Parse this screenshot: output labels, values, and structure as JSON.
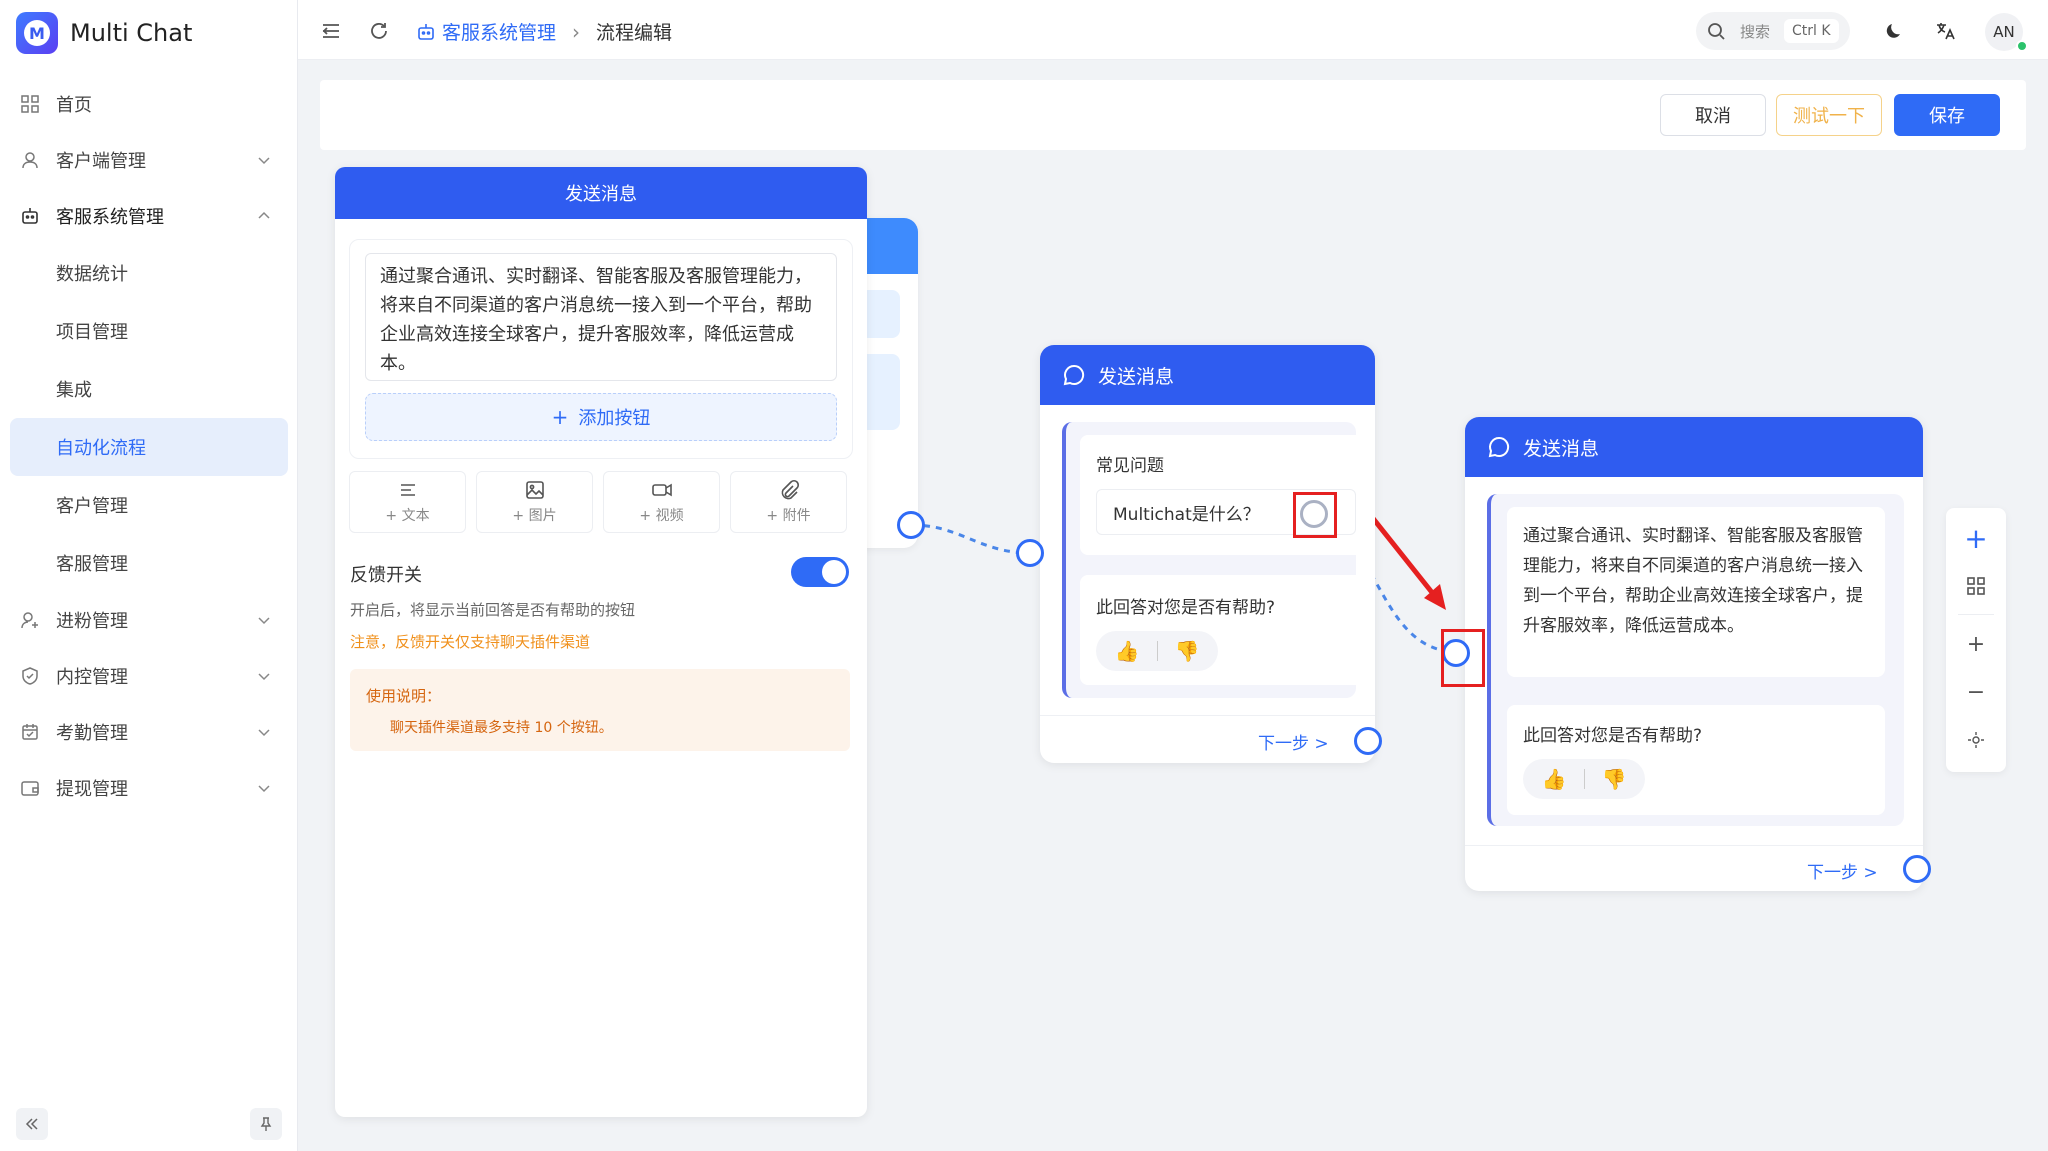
{
  "app": {
    "name": "Multi Chat",
    "logo_letter": "M"
  },
  "sidebar": {
    "items": [
      {
        "label": "首页",
        "icon": "grid-icon",
        "expandable": false
      },
      {
        "label": "客户端管理",
        "icon": "user-icon",
        "expandable": true,
        "expanded": false
      },
      {
        "label": "客服系统管理",
        "icon": "robot-icon",
        "expandable": true,
        "expanded": true
      },
      {
        "label": "进粉管理",
        "icon": "user-add-icon",
        "expandable": true,
        "expanded": false
      },
      {
        "label": "内控管理",
        "icon": "shield-icon",
        "expandable": true,
        "expanded": false
      },
      {
        "label": "考勤管理",
        "icon": "calendar-check-icon",
        "expandable": true,
        "expanded": false
      },
      {
        "label": "提现管理",
        "icon": "wallet-icon",
        "expandable": true,
        "expanded": false
      }
    ],
    "sub_items": [
      {
        "label": "数据统计",
        "active": false
      },
      {
        "label": "项目管理",
        "active": false
      },
      {
        "label": "集成",
        "active": false
      },
      {
        "label": "自动化流程",
        "active": true
      },
      {
        "label": "客户管理",
        "active": false
      },
      {
        "label": "客服管理",
        "active": false
      }
    ]
  },
  "header": {
    "breadcrumb_parent": "客服系统管理",
    "breadcrumb_current": "流程编辑",
    "search_placeholder": "搜索",
    "search_shortcut": "Ctrl K",
    "avatar_initials": "AN"
  },
  "toolbar": {
    "cancel_label": "取消",
    "test_label": "测试一下",
    "save_label": "保存"
  },
  "editor": {
    "title": "发送消息",
    "message_text": "通过聚合通讯、实时翻译、智能客服及客服管理能力，将来自不同渠道的客户消息统一接入到一个平台，帮助企业高效连接全球客户，提升客服效率，降低运营成本。",
    "add_button_label": "添加按钮",
    "type_buttons": [
      {
        "label": "+ 文本",
        "icon": "text-lines-icon"
      },
      {
        "label": "+ 图片",
        "icon": "image-icon"
      },
      {
        "label": "+ 视频",
        "icon": "video-icon"
      },
      {
        "label": "+ 附件",
        "icon": "paperclip-icon"
      }
    ],
    "feedback_title": "反馈开关",
    "feedback_enabled": true,
    "feedback_desc": "开启后，将显示当前回答是否有帮助的按钮",
    "feedback_warning": "注意，反馈开关仅支持聊天插件渠道",
    "usage_title": "使用说明：",
    "usage_text": "聊天插件渠道最多支持 10 个按钮。"
  },
  "node_faq": {
    "title": "发送消息",
    "section_label": "常见问题",
    "question": "Multichat是什么？",
    "feedback_question": "此回答对您是否有帮助?",
    "next_label": "下一步 >"
  },
  "node_answer": {
    "title": "发送消息",
    "message_text": "通过聚合通讯、实时翻译、智能客服及客服管理能力，将来自不同渠道的客户消息统一接入到一个平台，帮助企业高效连接全球客户，提升客服效率，降低运营成本。",
    "feedback_question": "此回答对您是否有帮助?",
    "next_label": "下一步 >"
  },
  "colors": {
    "primary": "#2f6bf6",
    "node_header": "#2f5cf0",
    "warning": "#f0901b",
    "annotation": "#e52020"
  }
}
